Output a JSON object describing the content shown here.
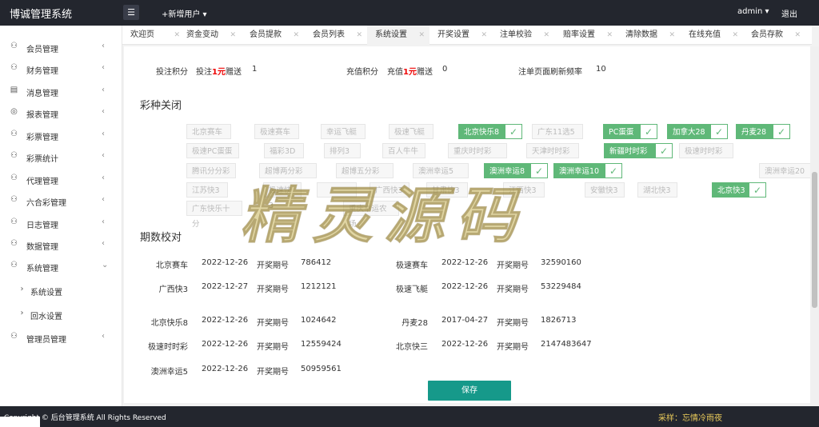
{
  "app": {
    "title": "博诚管理系统",
    "add_user": "+新增用户 ▾",
    "admin": "admin ▾",
    "logout": "退出"
  },
  "sidebar": {
    "items": [
      {
        "label": "会员管理",
        "icon": "user-icon",
        "arrow": "<"
      },
      {
        "label": "财务管理",
        "icon": "user-icon",
        "arrow": "<"
      },
      {
        "label": "消息管理",
        "icon": "message-icon",
        "arrow": "<"
      },
      {
        "label": "报表管理",
        "icon": "report-icon",
        "arrow": "<"
      },
      {
        "label": "彩票管理",
        "icon": "user-icon",
        "arrow": "<"
      },
      {
        "label": "彩票统计",
        "icon": "user-icon",
        "arrow": "<"
      },
      {
        "label": "代理管理",
        "icon": "user-icon",
        "arrow": "<"
      },
      {
        "label": "六合彩管理",
        "icon": "user-icon",
        "arrow": "<"
      },
      {
        "label": "日志管理",
        "icon": "user-icon",
        "arrow": "<"
      },
      {
        "label": "数据管理",
        "icon": "user-icon",
        "arrow": "<"
      },
      {
        "label": "系统管理",
        "icon": "user-icon",
        "arrow": "v"
      },
      {
        "label": "系统设置",
        "icon": "chevron-right-icon",
        "arrow": ""
      },
      {
        "label": "回水设置",
        "icon": "chevron-right-icon",
        "arrow": ""
      },
      {
        "label": "管理员管理",
        "icon": "user-icon",
        "arrow": "<"
      }
    ]
  },
  "tabs": [
    "欢迎页",
    "资金变动",
    "会员提款",
    "会员列表",
    "系统设置",
    "开奖设置",
    "注单校验",
    "赔率设置",
    "清除数据",
    "在线充值",
    "会员存款"
  ],
  "settings": {
    "bet_points_label": "投注积分",
    "bet_points_prefix": "投注",
    "bet_points_red": "1元",
    "bet_points_suffix": "赠送",
    "bet_points_value": "1",
    "recharge_label": "充值积分",
    "recharge_prefix": "充值",
    "recharge_red": "1元",
    "recharge_suffix": "赠送",
    "recharge_value": "0",
    "refresh_label": "注单页面刷新频率",
    "refresh_value": "10"
  },
  "lottery_close_title": "彩种关闭",
  "lotteries": [
    {
      "name": "北京赛车",
      "on": false
    },
    {
      "name": "极速赛车",
      "on": false
    },
    {
      "name": "幸运飞艇",
      "on": false
    },
    {
      "name": "极速飞艇",
      "on": false
    },
    {
      "name": "北京快乐8",
      "on": true
    },
    {
      "name": "广东11选5",
      "on": false
    },
    {
      "name": "PC蛋蛋",
      "on": true
    },
    {
      "name": "加拿大28",
      "on": true
    },
    {
      "name": "丹麦28",
      "on": true
    },
    {
      "name": "极速PC蛋蛋",
      "on": false
    },
    {
      "name": "福彩3D",
      "on": false
    },
    {
      "name": "排列3",
      "on": false
    },
    {
      "name": "百人牛牛",
      "on": false
    },
    {
      "name": "重庆时时彩",
      "on": false
    },
    {
      "name": "天津时时彩",
      "on": false
    },
    {
      "name": "新疆时时彩",
      "on": true
    },
    {
      "name": "极速时时彩",
      "on": false
    },
    {
      "name": "腾讯分分彩",
      "on": false
    },
    {
      "name": "超博两分彩",
      "on": false
    },
    {
      "name": "超博五分彩",
      "on": false
    },
    {
      "name": "澳洲幸运5",
      "on": false
    },
    {
      "name": "澳洲幸运8",
      "on": true
    },
    {
      "name": "澳洲幸运10",
      "on": true
    },
    {
      "name": "澳洲幸运20",
      "on": false
    },
    {
      "name": "江苏快3",
      "on": false
    },
    {
      "name": "极速快3",
      "on": false
    },
    {
      "name": "",
      "on": false
    },
    {
      "name": "广西快3",
      "on": false
    },
    {
      "name": "甘肃快3",
      "on": false
    },
    {
      "name": "江西快3",
      "on": false
    },
    {
      "name": "安徽快3",
      "on": false
    },
    {
      "name": "湖北快3",
      "on": false
    },
    {
      "name": "北京快3",
      "on": true
    },
    {
      "name": "广东快乐十分",
      "on": false
    },
    {
      "name": "重庆幸运农场",
      "on": false
    },
    {
      "name": "",
      "on": false
    }
  ],
  "watermark": "精灵源码",
  "period_title": "期数校对",
  "periods": [
    {
      "name": "北京赛车",
      "date": "2022-12-26",
      "label": "开奖期号",
      "value": "786412"
    },
    {
      "name": "极速赛车",
      "date": "2022-12-26",
      "label": "开奖期号",
      "value": "32590160"
    },
    {
      "name": "广西快3",
      "date": "2022-12-27",
      "label": "开奖期号",
      "value": "1212121"
    },
    {
      "name": "极速飞艇",
      "date": "2022-12-26",
      "label": "开奖期号",
      "value": "53229484"
    },
    {
      "name": "北京快乐8",
      "date": "2022-12-26",
      "label": "开奖期号",
      "value": "1024642"
    },
    {
      "name": "丹麦28",
      "date": "2017-04-27",
      "label": "开奖期号",
      "value": "1826713"
    },
    {
      "name": "极速时时彩",
      "date": "2022-12-26",
      "label": "开奖期号",
      "value": "12559424"
    },
    {
      "name": "北京快三",
      "date": "2022-12-26",
      "label": "开奖期号",
      "value": "2147483647"
    },
    {
      "name": "澳洲幸运5",
      "date": "2022-12-26",
      "label": "开奖期号",
      "value": "50959561"
    }
  ],
  "save_label": "保存",
  "footer": {
    "text": "Copyright © 后台管理系统 All Rights Reserved",
    "credit": "采样：忘情冷雨夜"
  },
  "colors": {
    "accent": "#16998a",
    "checked": "#5fb878",
    "topbar": "#23262e"
  }
}
